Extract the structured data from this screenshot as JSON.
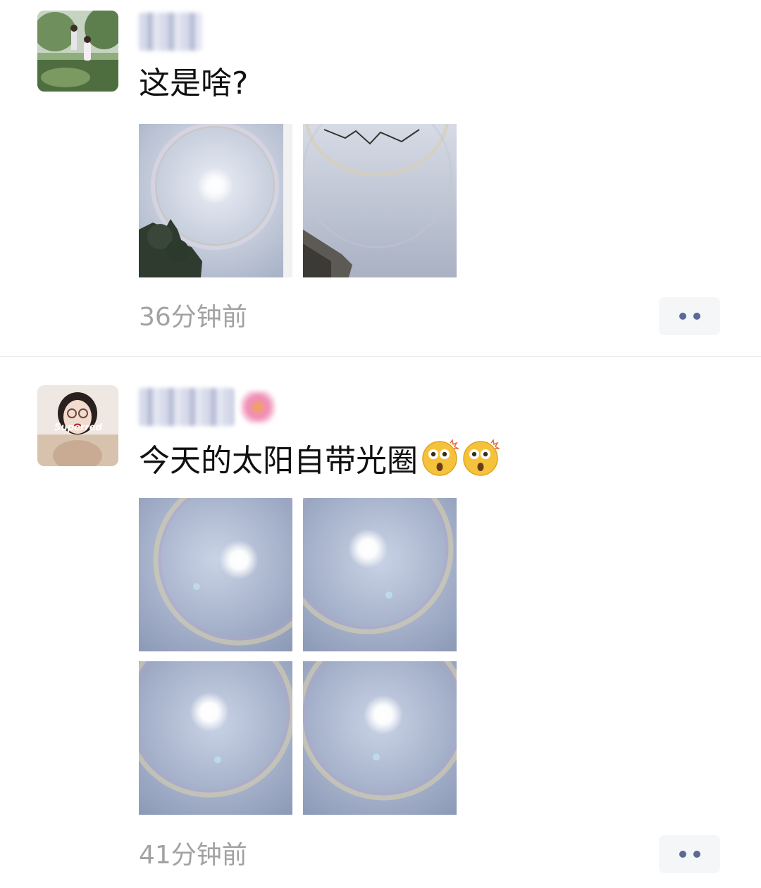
{
  "posts": [
    {
      "author_name": "",
      "text": "这是啥?",
      "emoji": [],
      "timestamp": "36分钟前",
      "photos": [
        "halo-photo",
        "halo-photo"
      ]
    },
    {
      "author_name": "",
      "avatar_caption": "Superred",
      "text": "今天的太阳自带光圈",
      "emoji": [
        "astonished-face",
        "astonished-face"
      ],
      "timestamp": "41分钟前",
      "photos": [
        "halo-photo",
        "halo-photo",
        "halo-photo",
        "halo-photo"
      ]
    }
  ],
  "icons": {
    "more": "more-dots-icon"
  },
  "colors": {
    "timestamp": "#a2a2a2",
    "more_button_bg": "#f5f6f8",
    "more_dots": "#5a6a95"
  }
}
